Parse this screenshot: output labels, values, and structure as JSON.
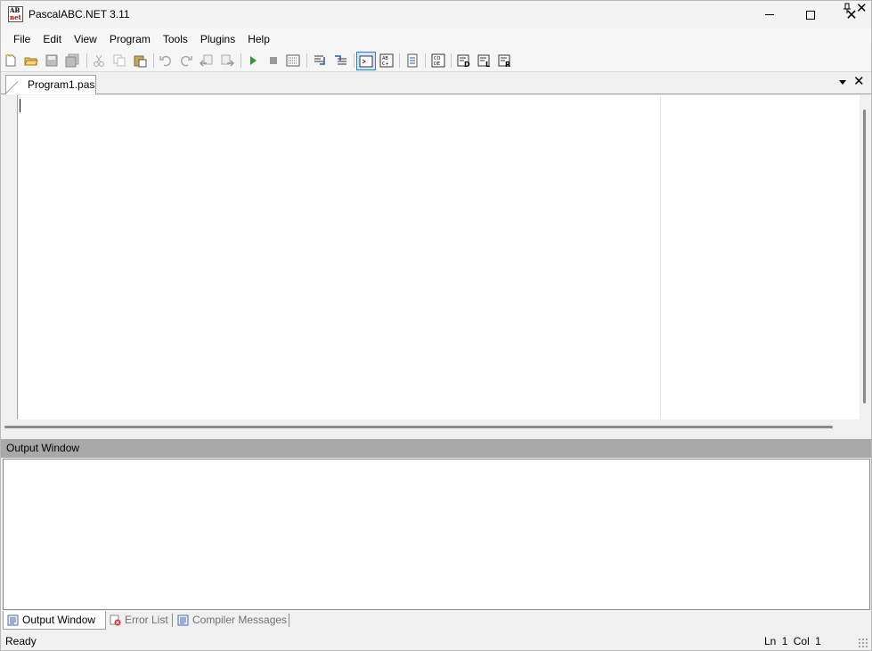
{
  "window": {
    "title": "PascalABC.NET 3.11",
    "icon_text_top": "AB",
    "icon_text_bottom": "net"
  },
  "menu": {
    "items": [
      "File",
      "Edit",
      "View",
      "Program",
      "Tools",
      "Plugins",
      "Help"
    ]
  },
  "toolbar": {
    "buttons": [
      "new-file-icon",
      "open-folder-icon",
      "save-icon",
      "save-all-icon",
      "cut-icon",
      "copy-icon",
      "paste-icon",
      "undo-icon",
      "redo-icon",
      "navigate-back-icon",
      "navigate-forward-icon",
      "run-icon",
      "stop-icon",
      "compile-icon",
      "step-into-icon",
      "step-over-icon",
      "console-icon",
      "format-code-icon",
      "goto-icon",
      "code-template-icon",
      "debug-d-icon",
      "debug-l-icon",
      "debug-r-icon"
    ],
    "active_button": "console-icon",
    "run_color": "#2e9a2e"
  },
  "editor": {
    "tab_label": "Program1.pas",
    "content": ""
  },
  "output": {
    "header": "Output Window",
    "content": ""
  },
  "bottom_tabs": [
    {
      "label": "Output Window",
      "active": true
    },
    {
      "label": "Error List",
      "active": false
    },
    {
      "label": "Compiler Messages",
      "active": false
    }
  ],
  "status": {
    "text": "Ready",
    "ln_label": "Ln",
    "ln": "1",
    "col_label": "Col",
    "col": "1"
  },
  "colors": {
    "output_header_bg": "#a8a8a8",
    "active_tool_border": "#3d7ab8"
  }
}
